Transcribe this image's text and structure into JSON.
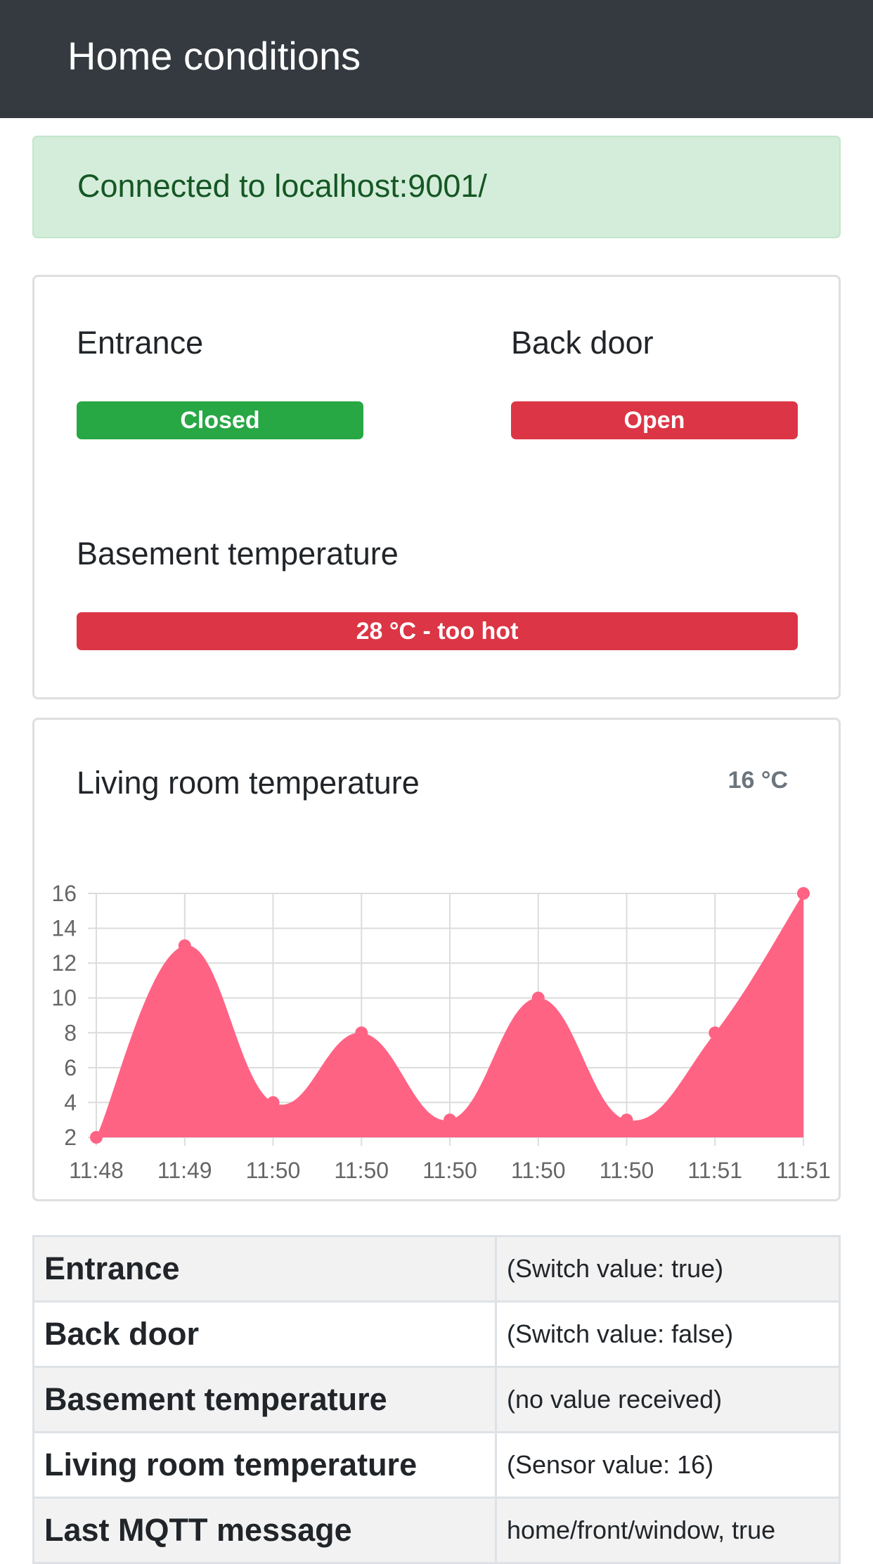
{
  "header": {
    "title": "Home conditions"
  },
  "connection": {
    "message": "Connected to localhost:9001/"
  },
  "status_card": {
    "items": [
      {
        "label": "Entrance",
        "badge": "Closed",
        "color": "#28a745"
      },
      {
        "label": "Back door",
        "badge": "Open",
        "color": "#dc3545"
      },
      {
        "label": "Basement temperature",
        "badge": "28 °C - too hot",
        "color": "#dc3545"
      }
    ]
  },
  "chart_card": {
    "title": "Living room temperature",
    "current_value": "16 °C"
  },
  "chart_data": {
    "type": "area",
    "title": "",
    "xlabel": "",
    "ylabel": "",
    "x": [
      "11:48",
      "11:49",
      "11:50",
      "11:50",
      "11:50",
      "11:50",
      "11:50",
      "11:51",
      "11:51"
    ],
    "series": [
      {
        "values": [
          2,
          13,
          4,
          8,
          3,
          10,
          3,
          8,
          16
        ],
        "color": "#ff6384"
      }
    ],
    "yticks": [
      2,
      4,
      6,
      8,
      10,
      12,
      14,
      16
    ],
    "ylim": [
      2,
      16
    ],
    "grid": true
  },
  "table": {
    "rows": [
      {
        "key": "Entrance",
        "value": "(Switch value: true)"
      },
      {
        "key": "Back door",
        "value": "(Switch value: false)"
      },
      {
        "key": "Basement temperature",
        "value": "(no value received)"
      },
      {
        "key": "Living room temperature",
        "value": "(Sensor value: 16)"
      },
      {
        "key": "Last MQTT message",
        "value": "home/front/window, true"
      }
    ]
  }
}
